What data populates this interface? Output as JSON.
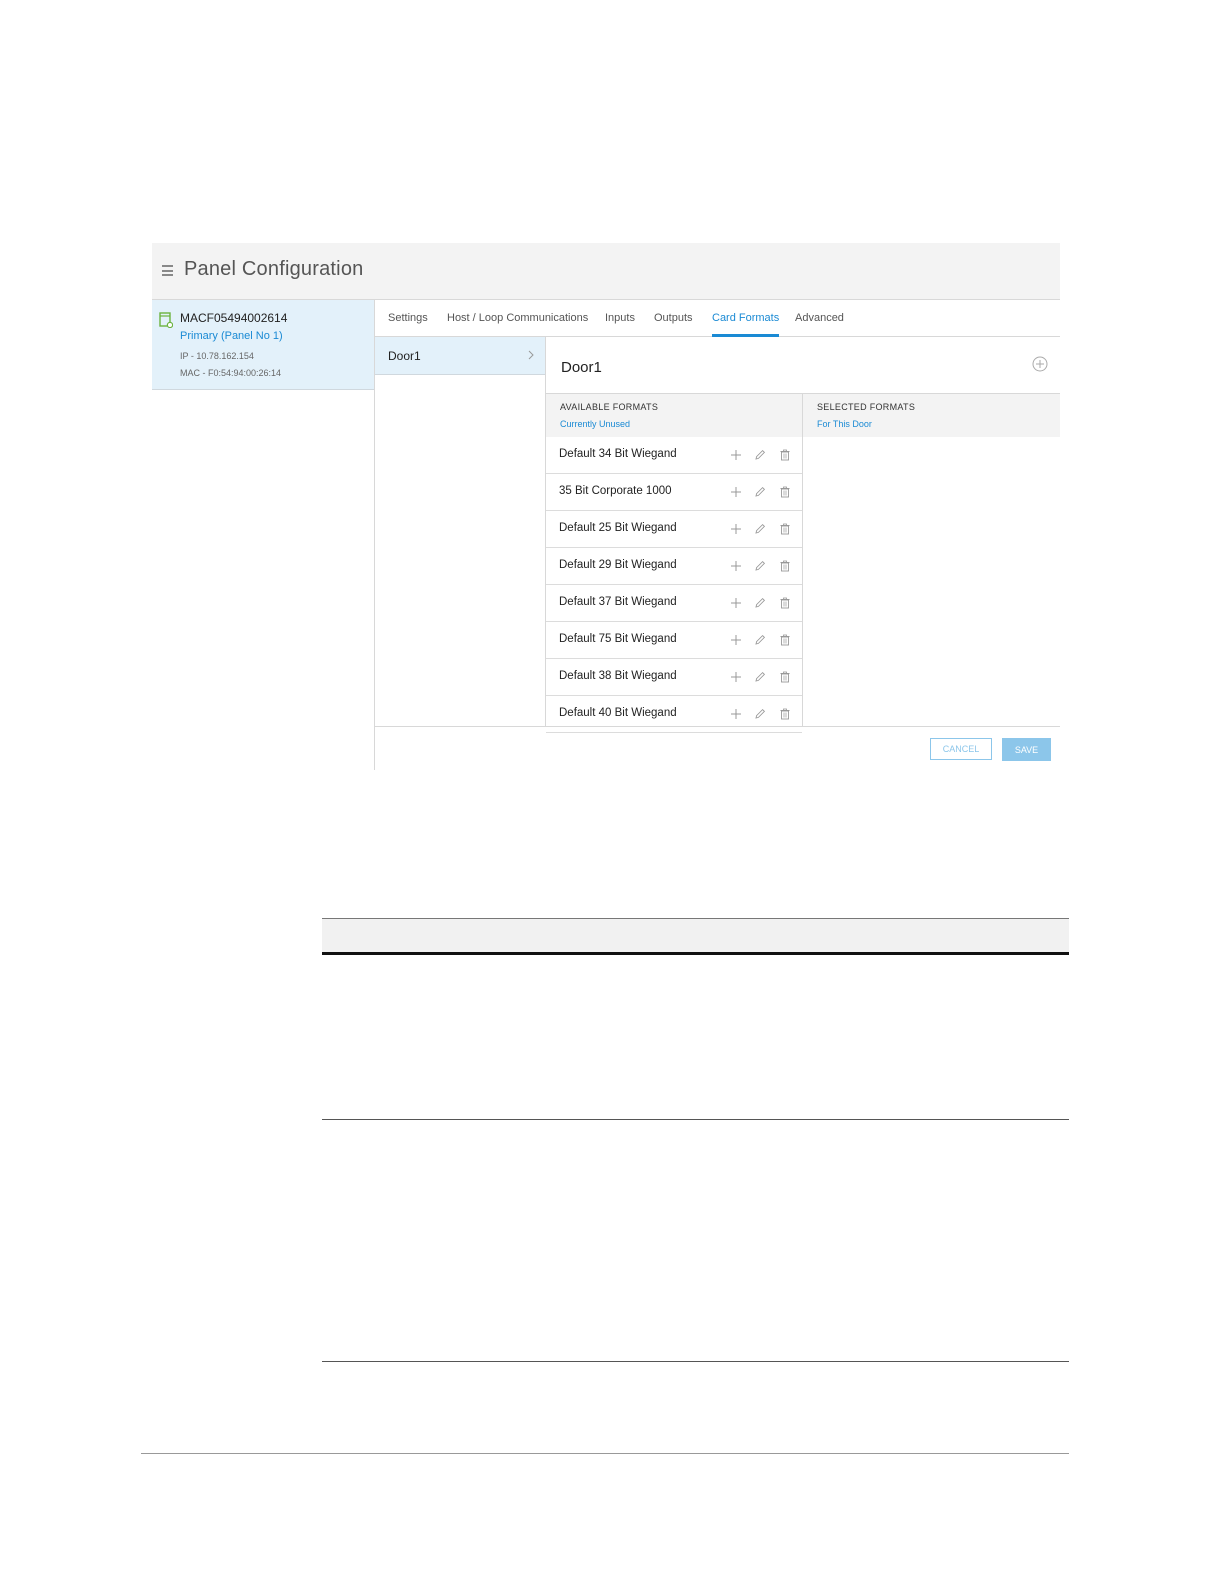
{
  "header": {
    "title": "Panel Configuration"
  },
  "panel": {
    "name": "MACF05494002614",
    "role": "Primary (Panel No 1)",
    "ip": "IP - 10.78.162.154",
    "mac": "MAC - F0:54:94:00:26:14"
  },
  "tabs": [
    {
      "label": "Settings"
    },
    {
      "label": "Host / Loop Communications"
    },
    {
      "label": "Inputs"
    },
    {
      "label": "Outputs"
    },
    {
      "label": "Card Formats",
      "active": true
    },
    {
      "label": "Advanced"
    }
  ],
  "doors": [
    {
      "label": "Door1"
    }
  ],
  "door_detail": {
    "title": "Door1"
  },
  "available": {
    "title": "AVAILABLE FORMATS",
    "subtitle": "Currently Unused"
  },
  "selected": {
    "title": "SELECTED FORMATS",
    "subtitle": "For This Door"
  },
  "formats": [
    "Default 34 Bit Wiegand",
    "35 Bit Corporate 1000",
    "Default 25 Bit Wiegand",
    "Default 29 Bit Wiegand",
    "Default 37 Bit Wiegand",
    "Default 75 Bit Wiegand",
    "Default 38 Bit Wiegand",
    "Default 40 Bit Wiegand"
  ],
  "footer": {
    "cancel_label": "CANCEL",
    "save_label": "SAVE"
  },
  "colors": {
    "accent": "#1a8ad4",
    "selected_bg": "#e3f1fa",
    "button": "#8cc6ea"
  },
  "icons": [
    "menu-icon",
    "panel-icon",
    "chevron-right-icon",
    "add-circle-icon",
    "plus-icon",
    "pencil-icon",
    "trash-icon"
  ]
}
